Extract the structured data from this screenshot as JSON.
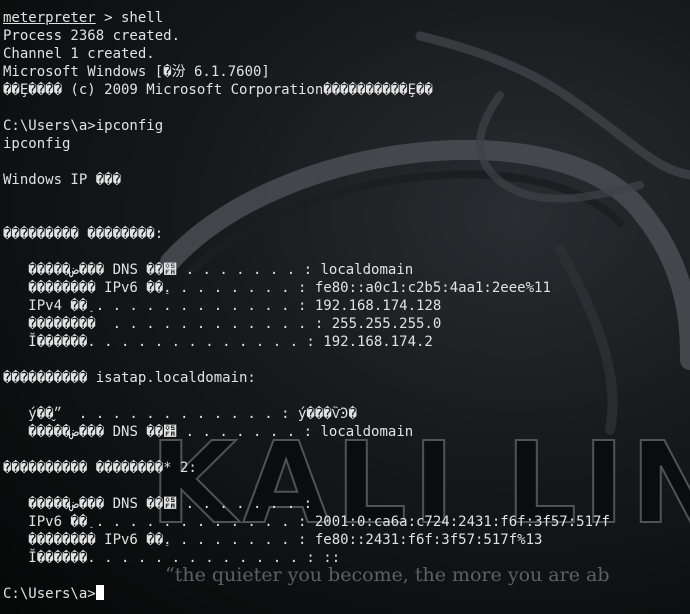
{
  "wallpaper": {
    "logo_text": "KALI LINU",
    "tagline": "“the quieter you become, the more you are ab"
  },
  "terminal": {
    "lines": [
      {
        "prompt": "meterpreter",
        "rest": " > shell"
      },
      {
        "text": "Process 2368 created."
      },
      {
        "text": "Channel 1 created."
      },
      {
        "text": "Microsoft Windows [�汾 6.1.7600]"
      },
      {
        "text": "��Ȩ���� (c) 2009 Microsoft Corporation����������Ȩ��"
      },
      {
        "text": ""
      },
      {
        "text": "C:\\Users\\a>ipconfig"
      },
      {
        "text": "ipconfig"
      },
      {
        "text": ""
      },
      {
        "text": "Windows IP ���"
      },
      {
        "text": ""
      },
      {
        "text": ""
      },
      {
        "text": "��������� ��������:"
      },
      {
        "text": ""
      },
      {
        "text": "   �����ض��� DNS ��׺ . . . . . . . : localdomain"
      },
      {
        "text": "   �������� IPv6 ��ַ. . . . . . . . : fe80::a0c1:c2b5:4aa1:2eee%11"
      },
      {
        "text": "   IPv4 ��ַ . . . . . . . . . . . . : 192.168.174.128"
      },
      {
        "text": "   ��������  . . . . . . . . . . . . : 255.255.255.0"
      },
      {
        "text": "   Ĭ������. . . . . . . . . . . . . : 192.168.174.2"
      },
      {
        "text": ""
      },
      {
        "text": "���������� isatap.localdomain:"
      },
      {
        "text": ""
      },
      {
        "text": "   ý��״̬  . . . . . . . . . . . . : ý���ѶϿ�"
      },
      {
        "text": "   �����ض��� DNS ��׺ . . . . . . . : localdomain"
      },
      {
        "text": ""
      },
      {
        "text": "���������� ��������* 2:"
      },
      {
        "text": ""
      },
      {
        "text": "   �����ض��� DNS ��׺ . . . . . . . :"
      },
      {
        "text": "   IPv6 ��ַ . . . . . . . . . . . . : 2001:0:ca6a:c724:2431:f6f:3f57:517f"
      },
      {
        "text": "   �������� IPv6 ��ַ. . . . . . . . : fe80::2431:f6f:3f57:517f%13"
      },
      {
        "text": "   Ĭ������. . . . . . . . . . . . . : ::"
      },
      {
        "text": ""
      },
      {
        "text": "C:\\Users\\a>"
      }
    ]
  }
}
